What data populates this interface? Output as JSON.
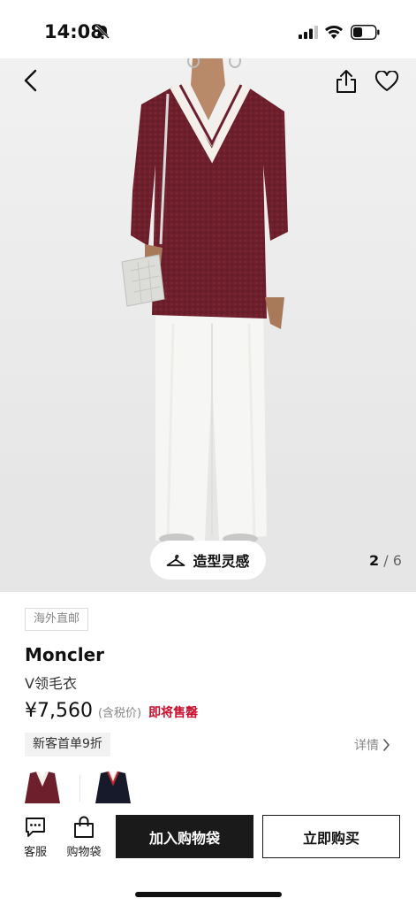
{
  "status_bar": {
    "time": "14:08",
    "icons": [
      "bell-off-icon",
      "signal-icon",
      "wifi-icon",
      "battery-icon"
    ]
  },
  "header": {
    "icons": [
      "back-arrow-icon",
      "share-icon",
      "heart-icon"
    ]
  },
  "gallery": {
    "style_button_label": "造型灵感",
    "current_page": "2",
    "separator": "/",
    "total_pages": "6"
  },
  "product": {
    "shipping_tag": "海外直邮",
    "brand": "Moncler",
    "name": "V领毛衣",
    "price": "¥7,560",
    "tax_note": "(含税价)",
    "stock_status": "即将售罄",
    "promo": "新客首单9折",
    "detail_link": "详情",
    "variants": [
      "burgundy",
      "navy"
    ]
  },
  "bottom_bar": {
    "service_label": "客服",
    "bag_label": "购物袋",
    "add_to_cart_label": "加入购物袋",
    "buy_now_label": "立即购买"
  },
  "colors": {
    "accent_red": "#c8102e",
    "primary_button": "#1a1a1a",
    "sweater": "#6e1f2c"
  }
}
